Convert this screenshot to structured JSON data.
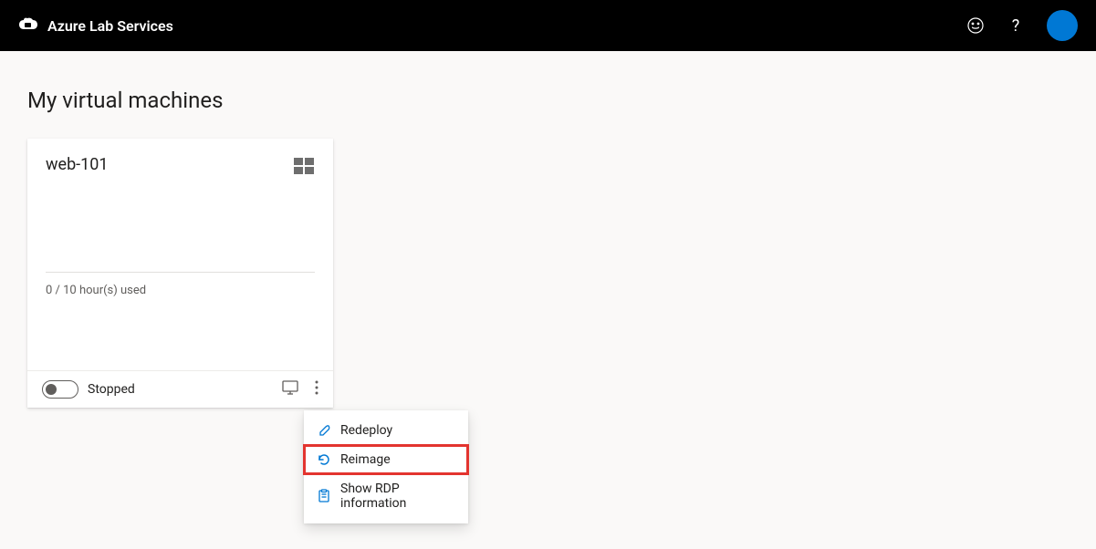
{
  "header": {
    "brand": "Azure Lab Services"
  },
  "page": {
    "title": "My virtual machines"
  },
  "vm": {
    "name": "web-101",
    "hours_text": "0 / 10 hour(s) used",
    "status": "Stopped"
  },
  "menu": {
    "redeploy": "Redeploy",
    "reimage": "Reimage",
    "show_rdp": "Show RDP information"
  }
}
